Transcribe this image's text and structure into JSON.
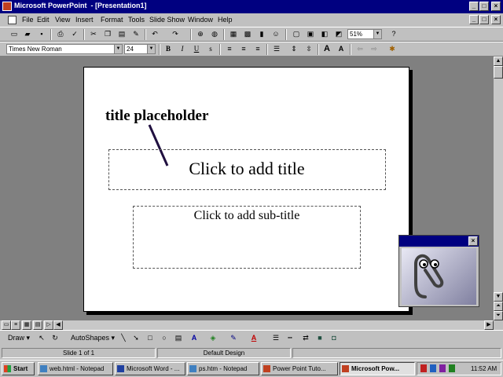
{
  "window": {
    "title": "Microsoft PowerPoint  - [Presentation1]"
  },
  "menubar": {
    "items": [
      "File",
      "Edit",
      "View",
      "Insert",
      "Format",
      "Tools",
      "Slide Show",
      "Window",
      "Help"
    ]
  },
  "format_toolbar": {
    "font_name": "Times New Roman",
    "font_size": "24"
  },
  "standard_toolbar": {
    "zoom": "51%"
  },
  "slide": {
    "annotation": "title placeholder",
    "title_placeholder": "Click to add title",
    "subtitle_placeholder": "Click to add sub-title"
  },
  "drawing_toolbar": {
    "draw_label": "Draw",
    "autoshapes_label": "AutoShapes"
  },
  "status": {
    "slide": "Slide 1 of 1",
    "design": "Default Design"
  },
  "taskbar": {
    "start_label": "Start",
    "tasks": [
      "web.html - Notepad",
      "Microsoft Word - ...",
      "ps.htm - Notepad",
      "Power Point Tuto...",
      "Microsoft Pow..."
    ],
    "clock": "11:52 AM"
  },
  "colors": {
    "titlebar": "#000080",
    "face": "#c0c0c0",
    "workspace": "#808080"
  }
}
